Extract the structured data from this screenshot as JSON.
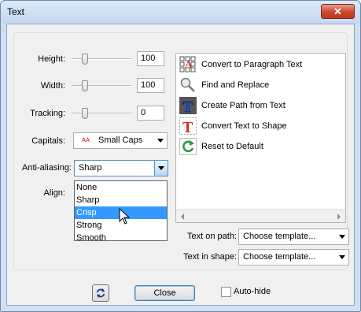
{
  "window": {
    "title": "Text",
    "close_glyph": "✕"
  },
  "fields": {
    "height": {
      "label": "Height:",
      "value": "100",
      "slider_fraction": 0.18
    },
    "width": {
      "label": "Width:",
      "value": "100",
      "slider_fraction": 0.18
    },
    "tracking": {
      "label": "Tracking:",
      "value": "0",
      "slider_fraction": 0.18
    }
  },
  "capitals": {
    "label": "Capitals:",
    "icon": "small-caps-icon",
    "glyph": "ᴀᴀ",
    "value": "Small Caps"
  },
  "antialiasing": {
    "label": "Anti-aliasing:",
    "value": "Sharp",
    "options": [
      "None",
      "Sharp",
      "Crisp",
      "Strong",
      "Smooth"
    ],
    "highlighted": "Crisp"
  },
  "align": {
    "label": "Align:"
  },
  "commands": [
    {
      "label": "Convert to Paragraph Text",
      "icon": "paragraph-text-icon"
    },
    {
      "label": "Find and Replace",
      "icon": "magnifier-icon"
    },
    {
      "label": "Create Path from Text",
      "icon": "path-from-text-icon"
    },
    {
      "label": "Convert Text to Shape",
      "icon": "text-to-shape-icon"
    },
    {
      "label": "Reset to Default",
      "icon": "reset-icon"
    }
  ],
  "text_on_path": {
    "label": "Text on path:",
    "value": "Choose template..."
  },
  "text_in_shape": {
    "label": "Text in shape:",
    "value": "Choose template..."
  },
  "footer": {
    "refresh_icon": "refresh-icon",
    "close_label": "Close",
    "autohide_label": "Auto-hide"
  },
  "colors": {
    "accent": "#3399ff",
    "titlebar": "#c3d8ef",
    "close_button": "#c9462f"
  }
}
